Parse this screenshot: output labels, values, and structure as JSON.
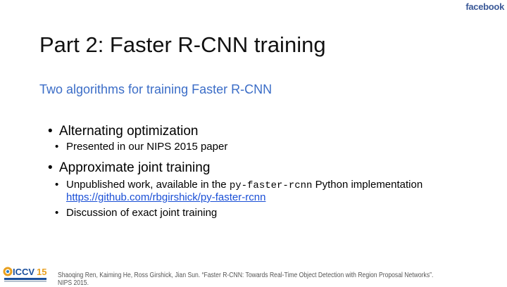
{
  "brand": "facebook",
  "title": "Part 2: Faster R-CNN training",
  "subtitle": "Two algorithms for training Faster R-CNN",
  "bullets": [
    {
      "text": "Alternating optimization",
      "sub": [
        {
          "text": "Presented in our NIPS 2015 paper"
        }
      ]
    },
    {
      "text": "Approximate joint training",
      "sub": [
        {
          "pre": "Unpublished work, available in the ",
          "code": "py-faster-rcnn",
          "post": " Python implementation",
          "link": "https://github.com/rbgirshick/py-faster-rcnn"
        },
        {
          "text": "Discussion of exact joint training"
        }
      ]
    }
  ],
  "logo": "ICCV15",
  "footer": "Shaoqing Ren, Kaiming He, Ross Girshick, Jian Sun. “Faster R-CNN: Towards Real-Time Object Detection with Region Proposal Networks”. NIPS 2015.",
  "colors": {
    "brand": "#3b5998",
    "subtitle": "#3b6dc7",
    "link": "#1a4fd6"
  }
}
